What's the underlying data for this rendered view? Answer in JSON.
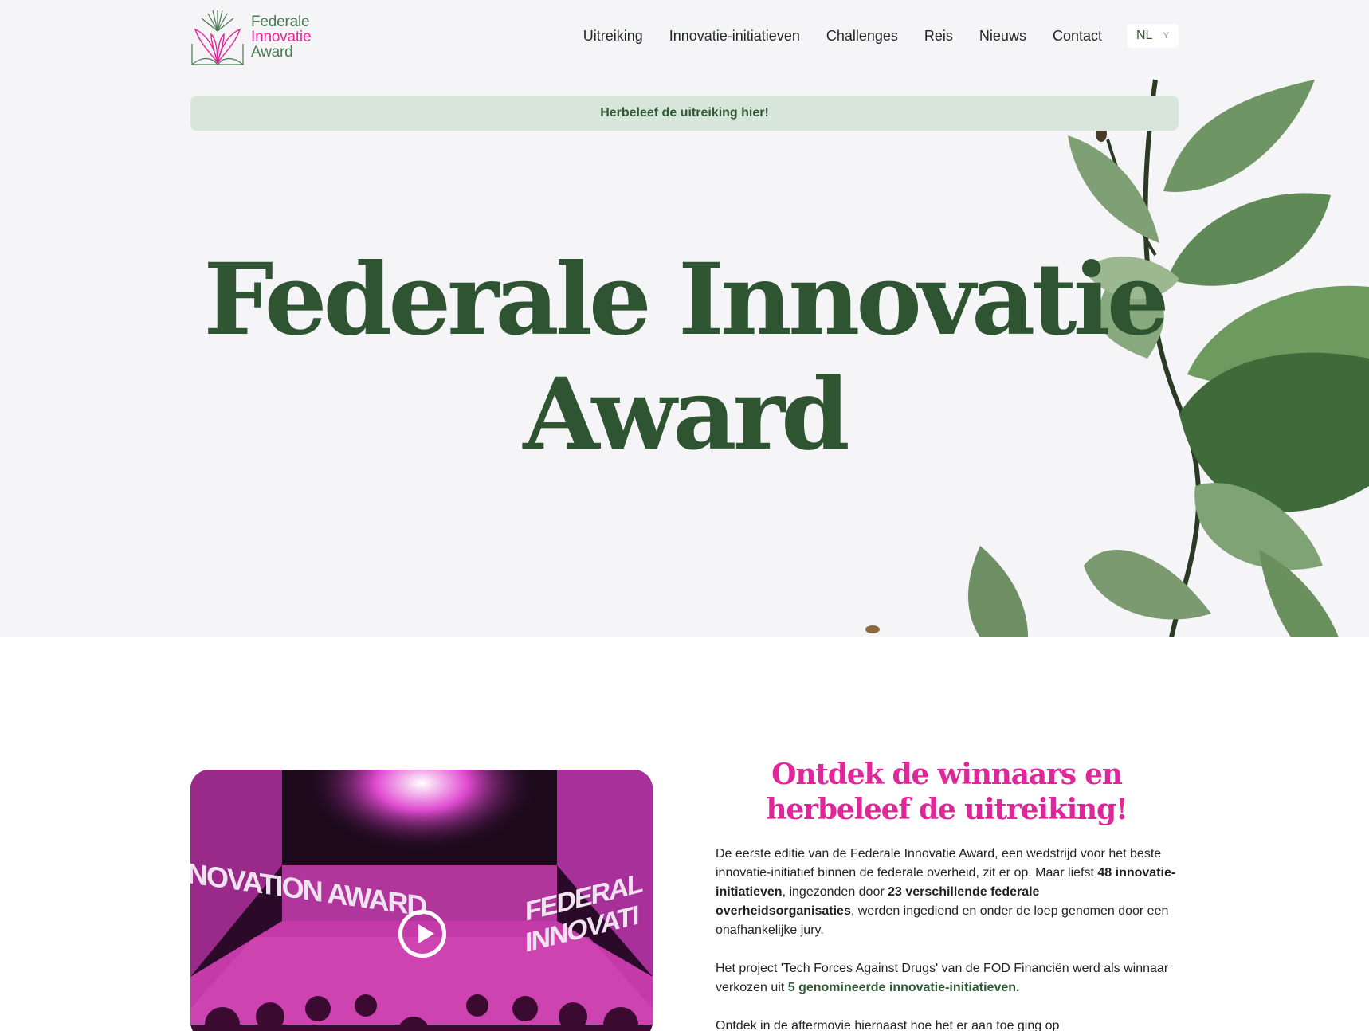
{
  "header": {
    "logo": {
      "line1": "Federale",
      "line2": "Innovatie",
      "line3": "Award"
    },
    "nav": [
      {
        "label": "Uitreiking"
      },
      {
        "label": "Innovatie-initiatieven"
      },
      {
        "label": "Challenges"
      },
      {
        "label": "Reis"
      },
      {
        "label": "Nieuws"
      },
      {
        "label": "Contact"
      }
    ],
    "language": {
      "selected": "NL",
      "chevron": "Y"
    }
  },
  "banner": {
    "label": "Herbeleef de uitreiking hier!"
  },
  "hero": {
    "title_line1": "Federale Innovatie",
    "title_line2": "Award"
  },
  "video": {
    "left_wall_text": "NOVATION AWARD",
    "right_wall_text": "FEDERAL INNOVATI",
    "icon": "play-icon"
  },
  "intro": {
    "heading": "Ontdek de winnaars en herbeleef de uitreiking!",
    "p1": {
      "t1": "De eerste editie van de Federale Innovatie Award, een wedstrijd voor het beste innovatie-initiatief binnen de federale overheid, zit er op. Maar liefst ",
      "b1": "48 innovatie-initiatieven",
      "t2": ", ingezonden door ",
      "b2": "23 verschillende federale overheidsorganisaties",
      "t3": ", werden ingediend en onder de loep genomen door een onafhankelijke jury."
    },
    "p2": {
      "t1": "Het project 'Tech Forces Against Drugs' van de FOD Financiën werd als winnaar verkozen uit ",
      "b1": "5 genomineerde innovatie-initiatieven."
    },
    "p3": {
      "t1": "Ontdek in de aftermovie hiernaast hoe het er aan toe ging op"
    }
  },
  "colors": {
    "brand_green": "#2e5432",
    "brand_pink": "#e0279a",
    "banner_bg": "#d8e5da",
    "hero_bg": "#f5f4f7"
  }
}
